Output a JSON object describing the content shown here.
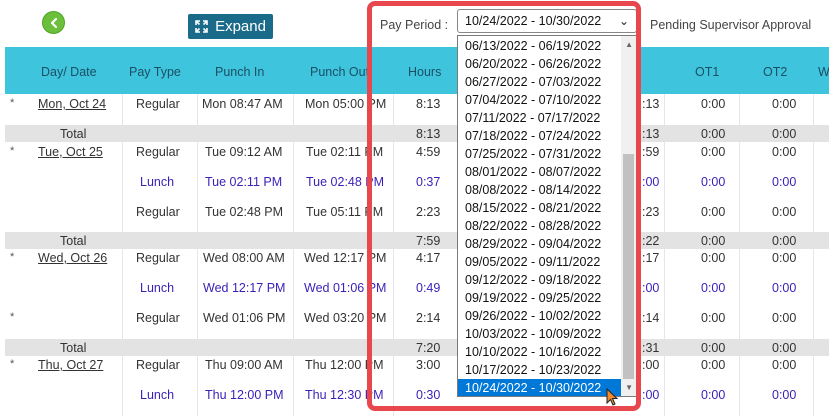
{
  "toolbar": {
    "expand_label": "Expand",
    "pay_period_label": "Pay Period :",
    "pay_period_selected": "10/24/2022 - 10/30/2022",
    "status": "Pending Supervisor Approval"
  },
  "columns": [
    "Day/ Date",
    "Pay Type",
    "Punch In",
    "Punch Out",
    "Hours",
    "OT1",
    "OT2",
    "W"
  ],
  "rows": {
    "r0": {
      "star": "*",
      "day": "Mon, Oct 24",
      "type": "Regular",
      "in": "Mon 08:47 AM",
      "out": "Mon 05:00 PM",
      "hours": "8:13",
      "reg": ":13",
      "ot1": "0:00",
      "ot2": "0:00"
    },
    "t0": {
      "label": "Total",
      "hours": "8:13",
      "reg": ":13",
      "ot1": "0:00",
      "ot2": "0:00"
    },
    "r1": {
      "star": "*",
      "day": "Tue, Oct 25",
      "type": "Regular",
      "in": "Tue 09:12 AM",
      "out": "Tue 02:11 PM",
      "hours": "4:59",
      "reg": ":59",
      "ot1": "0:00",
      "ot2": "0:00"
    },
    "r2": {
      "type": "Lunch",
      "in": "Tue 02:11 PM",
      "out": "Tue 02:48 PM",
      "hours": "0:37",
      "reg": ":00",
      "ot1": "0:00",
      "ot2": "0:00"
    },
    "r3": {
      "type": "Regular",
      "in": "Tue 02:48 PM",
      "out": "Tue 05:11 PM",
      "hours": "2:23",
      "reg": ":23",
      "ot1": "0:00",
      "ot2": "0:00"
    },
    "t1": {
      "label": "Total",
      "hours": "7:59",
      "reg": ":22",
      "ot1": "0:00",
      "ot2": "0:00"
    },
    "r4": {
      "star": "*",
      "day": "Wed, Oct 26",
      "type": "Regular",
      "in": "Wed 08:00 AM",
      "out": "Wed 12:17 PM",
      "hours": "4:17",
      "reg": ":17",
      "ot1": "0:00",
      "ot2": "0:00"
    },
    "r5": {
      "type": "Lunch",
      "in": "Wed 12:17 PM",
      "out": "Wed 01:06 PM",
      "hours": "0:49",
      "reg": ":00",
      "ot1": "0:00",
      "ot2": "0:00"
    },
    "r6": {
      "star": "*",
      "type": "Regular",
      "in": "Wed 01:06 PM",
      "out": "Wed 03:20 PM",
      "hours": "2:14",
      "reg": ":14",
      "ot1": "0:00",
      "ot2": "0:00"
    },
    "t2": {
      "label": "Total",
      "hours": "7:20",
      "reg": ":31",
      "ot1": "0:00",
      "ot2": "0:00"
    },
    "r7": {
      "star": "*",
      "day": "Thu, Oct 27",
      "type": "Regular",
      "in": "Thu 09:00 AM",
      "out": "Thu 12:00 PM",
      "hours": "3:00",
      "reg": ":00",
      "ot1": "0:00",
      "ot2": "0:00"
    },
    "r8": {
      "type": "Lunch",
      "in": "Thu 12:00 PM",
      "out": "Thu 12:30 PM",
      "hours": "0:30",
      "reg": ":00",
      "ot1": "0:00",
      "ot2": "0:00"
    }
  },
  "dropdown_options": [
    "06/13/2022 - 06/19/2022",
    "06/20/2022 - 06/26/2022",
    "06/27/2022 - 07/03/2022",
    "07/04/2022 - 07/10/2022",
    "07/11/2022 - 07/17/2022",
    "07/18/2022 - 07/24/2022",
    "07/25/2022 - 07/31/2022",
    "08/01/2022 - 08/07/2022",
    "08/08/2022 - 08/14/2022",
    "08/15/2022 - 08/21/2022",
    "08/22/2022 - 08/28/2022",
    "08/29/2022 - 09/04/2022",
    "09/05/2022 - 09/11/2022",
    "09/12/2022 - 09/18/2022",
    "09/19/2022 - 09/25/2022",
    "09/26/2022 - 10/02/2022",
    "10/03/2022 - 10/09/2022",
    "10/10/2022 - 10/16/2022",
    "10/17/2022 - 10/23/2022",
    "10/24/2022 - 10/30/2022"
  ],
  "icons": {
    "back": "back-arrow-icon",
    "expand": "expand-icon",
    "cursor": "mouse-pointer-icon"
  },
  "colors": {
    "header": "#3fc4de",
    "accent": "#1a6a8a",
    "highlight": "#e8474e",
    "selected": "#0078d7",
    "lunch_text": "#3a1fb8"
  }
}
